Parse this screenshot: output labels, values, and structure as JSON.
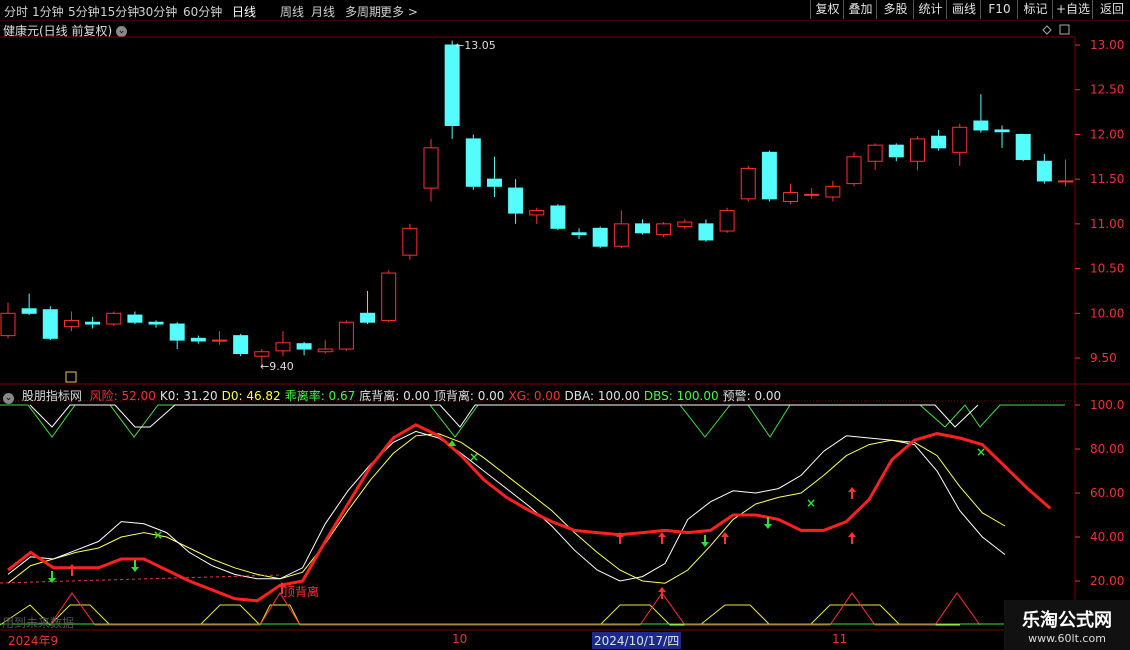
{
  "periods": [
    "分时",
    "1分钟",
    "5分钟",
    "15分钟",
    "30分钟",
    "60分钟",
    "日线",
    "周线",
    "月线",
    "多周期",
    "更多 >"
  ],
  "active_period": "日线",
  "right_buttons": [
    "复权",
    "叠加",
    "多股",
    "统计",
    "画线",
    "F10",
    "标记",
    "+自选",
    "返回"
  ],
  "chart_title": "健康元(日线 前复权)",
  "price_axis": [
    "13.00",
    "12.50",
    "12.00",
    "11.50",
    "11.00",
    "10.50",
    "10.00",
    "9.50"
  ],
  "high_label": "13.05",
  "low_label": "9.40",
  "indicator": {
    "name": "股朋指标网",
    "items": [
      {
        "label": "风险: 52.00",
        "color": "#ff3030"
      },
      {
        "label": "K0: 31.20",
        "color": "#e0e0e0"
      },
      {
        "label": "D0: 46.82",
        "color": "#ffff40"
      },
      {
        "label": "乖离率: 0.67",
        "color": "#40ff40"
      },
      {
        "label": "底背离: 0.00",
        "color": "#e0e0e0"
      },
      {
        "label": "顶背离: 0.00",
        "color": "#e0e0e0"
      },
      {
        "label": "XG: 0.00",
        "color": "#ff3030"
      },
      {
        "label": "DBA: 100.00",
        "color": "#e0e0e0"
      },
      {
        "label": "DBS: 100.00",
        "color": "#40ff40"
      },
      {
        "label": "预警: 0.00",
        "color": "#e0e0e0"
      }
    ]
  },
  "ind_axis": [
    "100.0",
    "80.00",
    "60.00",
    "40.00",
    "20.00"
  ],
  "annotation": "顶背离",
  "ghost_text": "用到未来数据",
  "x_labels": [
    {
      "text": "2024年9",
      "x": 8,
      "hl": false
    },
    {
      "text": "10",
      "x": 452,
      "hl": false
    },
    {
      "text": "2024/10/17/四",
      "x": 592,
      "hl": true
    },
    {
      "text": "11",
      "x": 832,
      "hl": false
    }
  ],
  "watermark": {
    "line1": "乐淘公式网",
    "line2": "www.60lt.com"
  },
  "colors": {
    "up": "#ff3030",
    "down": "#54fcfc",
    "grid": "#7a0000"
  },
  "chart_data": {
    "type": "candlestick",
    "ylim": [
      9.2,
      13.1
    ],
    "candles": [
      {
        "o": 9.75,
        "c": 10.0,
        "h": 10.12,
        "l": 9.72
      },
      {
        "o": 10.05,
        "c": 10.0,
        "h": 10.22,
        "l": 9.98
      },
      {
        "o": 10.04,
        "c": 9.72,
        "h": 10.08,
        "l": 9.7
      },
      {
        "o": 9.85,
        "c": 9.92,
        "h": 10.02,
        "l": 9.8
      },
      {
        "o": 9.9,
        "c": 9.88,
        "h": 9.96,
        "l": 9.83
      },
      {
        "o": 9.88,
        "c": 10.0,
        "h": 10.02,
        "l": 9.86
      },
      {
        "o": 9.98,
        "c": 9.9,
        "h": 10.02,
        "l": 9.88
      },
      {
        "o": 9.9,
        "c": 9.88,
        "h": 9.92,
        "l": 9.84
      },
      {
        "o": 9.88,
        "c": 9.7,
        "h": 9.9,
        "l": 9.6
      },
      {
        "o": 9.72,
        "c": 9.69,
        "h": 9.75,
        "l": 9.66
      },
      {
        "o": 9.7,
        "c": 9.7,
        "h": 9.8,
        "l": 9.65
      },
      {
        "o": 9.75,
        "c": 9.55,
        "h": 9.77,
        "l": 9.52
      },
      {
        "o": 9.52,
        "c": 9.57,
        "h": 9.6,
        "l": 9.4
      },
      {
        "o": 9.58,
        "c": 9.67,
        "h": 9.8,
        "l": 9.52
      },
      {
        "o": 9.66,
        "c": 9.6,
        "h": 9.68,
        "l": 9.53
      },
      {
        "o": 9.57,
        "c": 9.6,
        "h": 9.7,
        "l": 9.55
      },
      {
        "o": 9.6,
        "c": 9.9,
        "h": 9.92,
        "l": 9.58
      },
      {
        "o": 10.0,
        "c": 9.9,
        "h": 10.25,
        "l": 9.88
      },
      {
        "o": 9.92,
        "c": 10.45,
        "h": 10.48,
        "l": 9.9
      },
      {
        "o": 10.65,
        "c": 10.95,
        "h": 11.0,
        "l": 10.6
      },
      {
        "o": 11.4,
        "c": 11.85,
        "h": 11.95,
        "l": 11.25
      },
      {
        "o": 13.0,
        "c": 12.1,
        "h": 13.05,
        "l": 11.95
      },
      {
        "o": 11.95,
        "c": 11.42,
        "h": 12.0,
        "l": 11.38
      },
      {
        "o": 11.5,
        "c": 11.42,
        "h": 11.75,
        "l": 11.3
      },
      {
        "o": 11.4,
        "c": 11.12,
        "h": 11.5,
        "l": 11.0
      },
      {
        "o": 11.1,
        "c": 11.15,
        "h": 11.18,
        "l": 11.0
      },
      {
        "o": 11.2,
        "c": 10.95,
        "h": 11.22,
        "l": 10.93
      },
      {
        "o": 10.9,
        "c": 10.88,
        "h": 10.95,
        "l": 10.83
      },
      {
        "o": 10.95,
        "c": 10.75,
        "h": 10.97,
        "l": 10.73
      },
      {
        "o": 10.75,
        "c": 11.0,
        "h": 11.15,
        "l": 10.73
      },
      {
        "o": 11.0,
        "c": 10.9,
        "h": 11.05,
        "l": 10.88
      },
      {
        "o": 10.88,
        "c": 11.0,
        "h": 11.02,
        "l": 10.85
      },
      {
        "o": 10.97,
        "c": 11.02,
        "h": 11.05,
        "l": 10.94
      },
      {
        "o": 11.0,
        "c": 10.82,
        "h": 11.05,
        "l": 10.8
      },
      {
        "o": 10.92,
        "c": 11.15,
        "h": 11.18,
        "l": 10.9
      },
      {
        "o": 11.28,
        "c": 11.62,
        "h": 11.65,
        "l": 11.25
      },
      {
        "o": 11.8,
        "c": 11.28,
        "h": 11.82,
        "l": 11.25
      },
      {
        "o": 11.25,
        "c": 11.35,
        "h": 11.45,
        "l": 11.22
      },
      {
        "o": 11.32,
        "c": 11.33,
        "h": 11.4,
        "l": 11.28
      },
      {
        "o": 11.3,
        "c": 11.42,
        "h": 11.48,
        "l": 11.25
      },
      {
        "o": 11.45,
        "c": 11.75,
        "h": 11.8,
        "l": 11.42
      },
      {
        "o": 11.7,
        "c": 11.88,
        "h": 11.9,
        "l": 11.6
      },
      {
        "o": 11.88,
        "c": 11.75,
        "h": 11.9,
        "l": 11.7
      },
      {
        "o": 11.7,
        "c": 11.95,
        "h": 11.98,
        "l": 11.6
      },
      {
        "o": 11.98,
        "c": 11.85,
        "h": 12.05,
        "l": 11.82
      },
      {
        "o": 11.8,
        "c": 12.08,
        "h": 12.12,
        "l": 11.65
      },
      {
        "o": 12.15,
        "c": 12.05,
        "h": 12.45,
        "l": 12.02
      },
      {
        "o": 12.05,
        "c": 12.03,
        "h": 12.1,
        "l": 11.85
      },
      {
        "o": 12.0,
        "c": 11.72,
        "h": 12.0,
        "l": 11.7
      },
      {
        "o": 11.7,
        "c": 11.48,
        "h": 11.78,
        "l": 11.45
      },
      {
        "o": 11.48,
        "c": 11.48,
        "h": 11.72,
        "l": 11.42
      }
    ],
    "indicator_series": {
      "risk": [
        25,
        33,
        26,
        26,
        26,
        30,
        30,
        25,
        20,
        16,
        12,
        11,
        18,
        20,
        38,
        55,
        72,
        85,
        91,
        86,
        77,
        66,
        58,
        52,
        47,
        43,
        42,
        41,
        42,
        43,
        42,
        43,
        50,
        50,
        48,
        43,
        43,
        47,
        57,
        75,
        84,
        87,
        85,
        82,
        72,
        62,
        53
      ],
      "k0": [
        23,
        31,
        30,
        34,
        38,
        47,
        46,
        42,
        33,
        27,
        23,
        21,
        21,
        26,
        46,
        61,
        73,
        83,
        88,
        85,
        78,
        70,
        62,
        54,
        45,
        34,
        25,
        20,
        22,
        28,
        48,
        56,
        61,
        60,
        62,
        68,
        79,
        86,
        85,
        84,
        82,
        70,
        52,
        40,
        32
      ],
      "d0": [
        19,
        27,
        30,
        33,
        35,
        40,
        42,
        40,
        35,
        30,
        26,
        23,
        21,
        24,
        37,
        52,
        66,
        78,
        86,
        87,
        83,
        76,
        68,
        60,
        52,
        42,
        33,
        25,
        20,
        19,
        25,
        36,
        48,
        55,
        58,
        60,
        68,
        77,
        82,
        84,
        83,
        77,
        63,
        51,
        45
      ]
    }
  }
}
